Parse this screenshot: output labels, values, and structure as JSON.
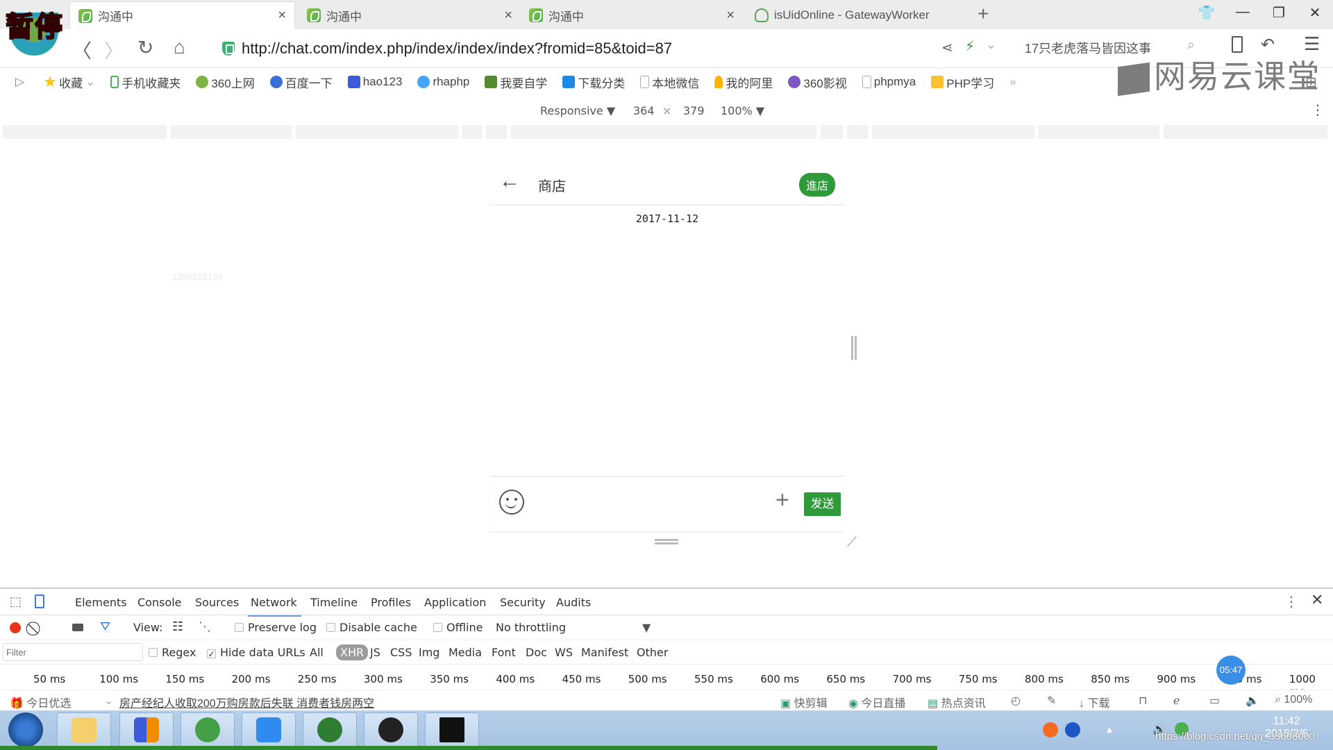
{
  "overlay": {
    "pause_label": "暂停",
    "timer": "05:47"
  },
  "tabs": [
    {
      "label": "沟通中",
      "active": true
    },
    {
      "label": "沟通中",
      "active": false
    },
    {
      "label": "沟通中",
      "active": false
    },
    {
      "label": "isUidOnline - GatewayWorker",
      "active": false
    }
  ],
  "tab_close": "×",
  "new_tab": "+",
  "window_controls": {
    "skin": "👕",
    "minimize": "—",
    "restore": "❐",
    "close": "✕"
  },
  "navbar": {
    "back": "〈",
    "forward": "〉",
    "reload": "↻",
    "home": "⌂",
    "url": "http://chat.com/index.php/index/index/index?fromid=85&toid=87",
    "news_ticker": "17只老虎落马皆因这事"
  },
  "bookmarks": [
    {
      "label": "收藏",
      "color": "#f5c518"
    },
    {
      "label": "手机收藏夹",
      "color": "#4caf50"
    },
    {
      "label": "360上网",
      "color": "#7cb342"
    },
    {
      "label": "百度一下",
      "color": "#3b6fd8"
    },
    {
      "label": "hao123",
      "color": "#3b5bdb"
    },
    {
      "label": "rhaphp",
      "color": "#42a5f5"
    },
    {
      "label": "我要自学",
      "color": "#558b2f"
    },
    {
      "label": "下载分类",
      "color": "#1e88e5"
    },
    {
      "label": "本地微信",
      "color": "#ffffff"
    },
    {
      "label": "我的阿里",
      "color": "#ffb300"
    },
    {
      "label": "360影视",
      "color": "#7e57c2"
    },
    {
      "label": "phpmya",
      "color": "#ffffff"
    },
    {
      "label": "PHP学习",
      "color": "#fbc02d"
    }
  ],
  "bookmarks_more": "»",
  "watermark_text": "网易云课堂",
  "device_toolbar": {
    "mode": "Responsive",
    "width": "364",
    "times": "×",
    "height": "379",
    "zoom": "100%"
  },
  "page": {
    "faint_number": "1386318130"
  },
  "chat": {
    "back_icon": "←",
    "title": "商店",
    "enter_shop_label": "進店",
    "date": "2017-11-12",
    "plus_icon": "+",
    "send_label": "发送"
  },
  "devtools": {
    "tabs": [
      "Elements",
      "Console",
      "Sources",
      "Network",
      "Timeline",
      "Profiles",
      "Application",
      "Security",
      "Audits"
    ],
    "active_tab": "Network",
    "view_label": "View:",
    "preserve_log": "Preserve log",
    "disable_cache": "Disable cache",
    "offline": "Offline",
    "throttling": "No throttling",
    "filter_placeholder": "Filter",
    "regex": "Regex",
    "hide_data_urls": "Hide data URLs",
    "hide_data_urls_checked": true,
    "types": [
      "All",
      "XHR",
      "JS",
      "CSS",
      "Img",
      "Media",
      "Font",
      "Doc",
      "WS",
      "Manifest",
      "Other"
    ],
    "active_type": "XHR",
    "ticks": [
      "50 ms",
      "100 ms",
      "150 ms",
      "200 ms",
      "250 ms",
      "300 ms",
      "350 ms",
      "400 ms",
      "450 ms",
      "500 ms",
      "550 ms",
      "600 ms",
      "650 ms",
      "700 ms",
      "750 ms",
      "800 ms",
      "850 ms",
      "900 ms",
      "950 ms",
      "1000 ms"
    ]
  },
  "statusbar": {
    "today_pick": "今日优选",
    "news": "房产经纪人收取200万购房款后失联 消费者钱房两空",
    "items": [
      "快剪辑",
      "今日直播",
      "热点资讯",
      "下载"
    ],
    "zoom": "100%"
  },
  "taskbar": {
    "clock_time": "11:42",
    "clock_date": "2018/2/6",
    "watermark": "https://blog.csdn.net/qq_33608000"
  }
}
